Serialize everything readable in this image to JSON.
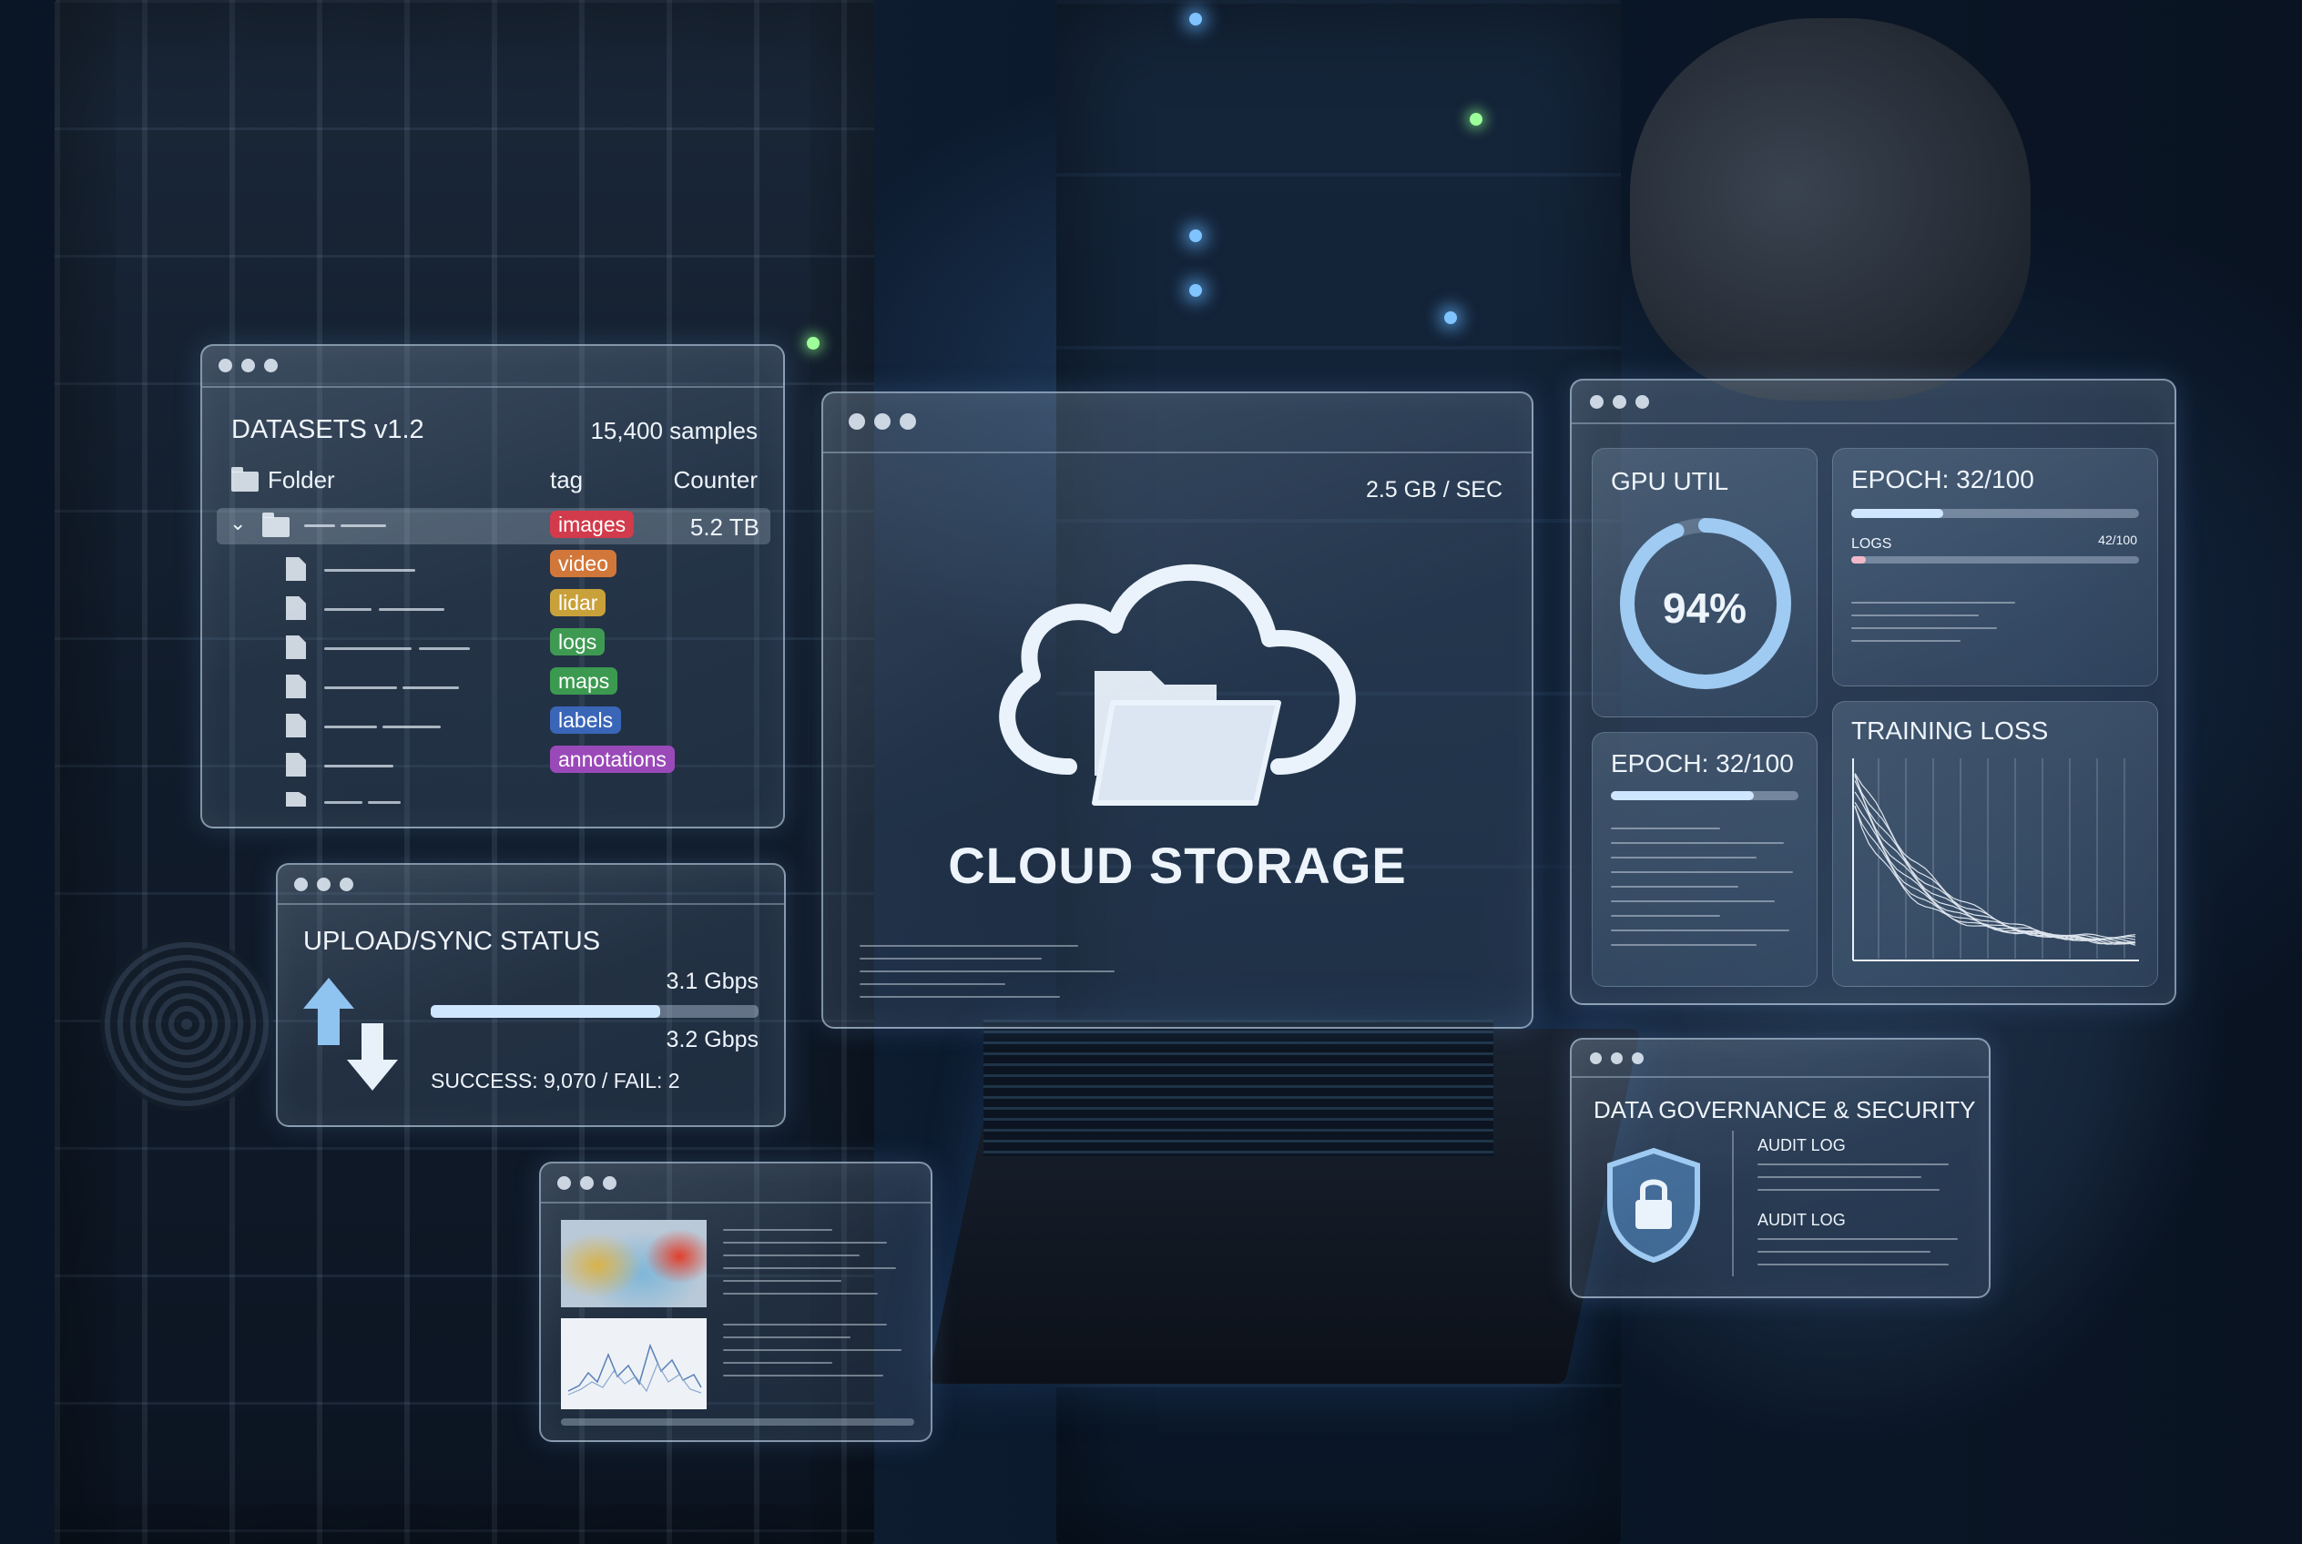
{
  "colors": {
    "tag_images": "#d23b4c",
    "tag_video": "#d2773a",
    "tag_lidar": "#c9a13a",
    "tag_logs": "#3e9a52",
    "tag_maps": "#3b9a50",
    "tag_labels": "#3a66b8",
    "tag_annotations": "#9a4ab8",
    "gauge": "#9fcaf2",
    "bar_fill": "#cfe6ff"
  },
  "datasets": {
    "title": "DATASETS v1.2",
    "sample_count": "15,400 samples",
    "col_folder": "Folder",
    "col_tag": "tag",
    "col_counter": "Counter",
    "selected_row_size": "5.2 TB",
    "tags": [
      "images",
      "video",
      "lidar",
      "logs",
      "maps",
      "labels",
      "annotations"
    ]
  },
  "upload": {
    "title": "UPLOAD/SYNC STATUS",
    "rate_up": "3.1 Gbps",
    "rate_down": "3.2 Gbps",
    "progress": 0.7,
    "result": "SUCCESS: 9,070 / FAIL: 2"
  },
  "cloud": {
    "throughput": "2.5 GB / SEC",
    "title": "CLOUD STORAGE"
  },
  "metrics": {
    "gpu_title": "GPU UTIL",
    "gpu_value": "94%",
    "gpu_fraction": 0.94,
    "epoch_title": "EPOCH: 32/100",
    "epoch_fraction": 0.32,
    "logs_label": "LOGS",
    "logs_count": "42/100",
    "logs_fraction": 0.05,
    "epoch2_title": "EPOCH: 32/100",
    "epoch2_fraction": 0.76,
    "loss_title": "TRAINING LOSS"
  },
  "governance": {
    "title": "DATA GOVERNANCE & SECURITY",
    "audit_1": "AUDIT LOG",
    "audit_2": "AUDIT LOG"
  }
}
